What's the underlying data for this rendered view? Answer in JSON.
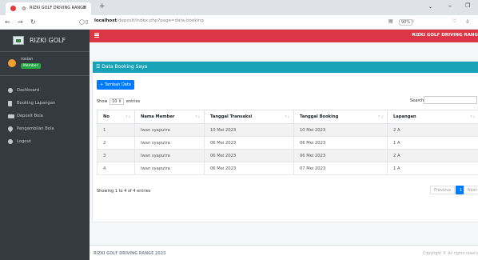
{
  "browser": {
    "tab_title": "RIZKI GOLF DRIVING RANGE",
    "url_host": "localhost",
    "url_path": "/deposit/index.php?page=data-booking",
    "zoom": "90%"
  },
  "sidebar": {
    "brand": "RIZKI GOLF",
    "user_name": "rosian",
    "user_role": "Member",
    "items": [
      {
        "label": "Dashboard",
        "icon": "dashboard-icon"
      },
      {
        "label": "Booking Lapangan",
        "icon": "bookmark-icon"
      },
      {
        "label": "Deposit Bola",
        "icon": "credit-card-icon"
      },
      {
        "label": "Pengambilan Bola",
        "icon": "map-pin-icon"
      },
      {
        "label": "Logout",
        "icon": "logout-icon"
      }
    ]
  },
  "navbar": {
    "title": "RIZKI GOLF DRIVING RANG"
  },
  "card": {
    "title": "Data Booking Saya",
    "add_button": "Tambah Data",
    "show_prefix": "Show",
    "show_value": "10",
    "show_suffix": "entries",
    "search_label": "Search:"
  },
  "table": {
    "headers": [
      "No",
      "Nama Member",
      "Tanggal Transaksi",
      "Tanggal Booking",
      "Lapangan"
    ],
    "rows": [
      [
        "1",
        "Iwan syaputra",
        "10 Mei 2023",
        "10 Mei 2023",
        "2 A"
      ],
      [
        "2",
        "Iwan syaputra",
        "06 Mei 2023",
        "06 Mei 2023",
        "1 A"
      ],
      [
        "3",
        "Iwan syaputra",
        "06 Mei 2023",
        "06 Mei 2023",
        "2 A"
      ],
      [
        "4",
        "Iwan syaputra",
        "06 Mei 2023",
        "07 Mei 2023",
        "1 A"
      ]
    ]
  },
  "pagination": {
    "info": "Showing 1 to 4 of 4 entries",
    "previous": "Previous",
    "current": "1",
    "next": "Next"
  },
  "footer": {
    "left": "RIZKI GOLF DRIVING RANGE 2023",
    "right": "Copyright © All rights reserv"
  },
  "colors": {
    "navbar": "#dc3545",
    "card_header": "#17a2b8",
    "primary": "#007bff",
    "sidebar": "#343a40",
    "badge": "#28a745"
  }
}
